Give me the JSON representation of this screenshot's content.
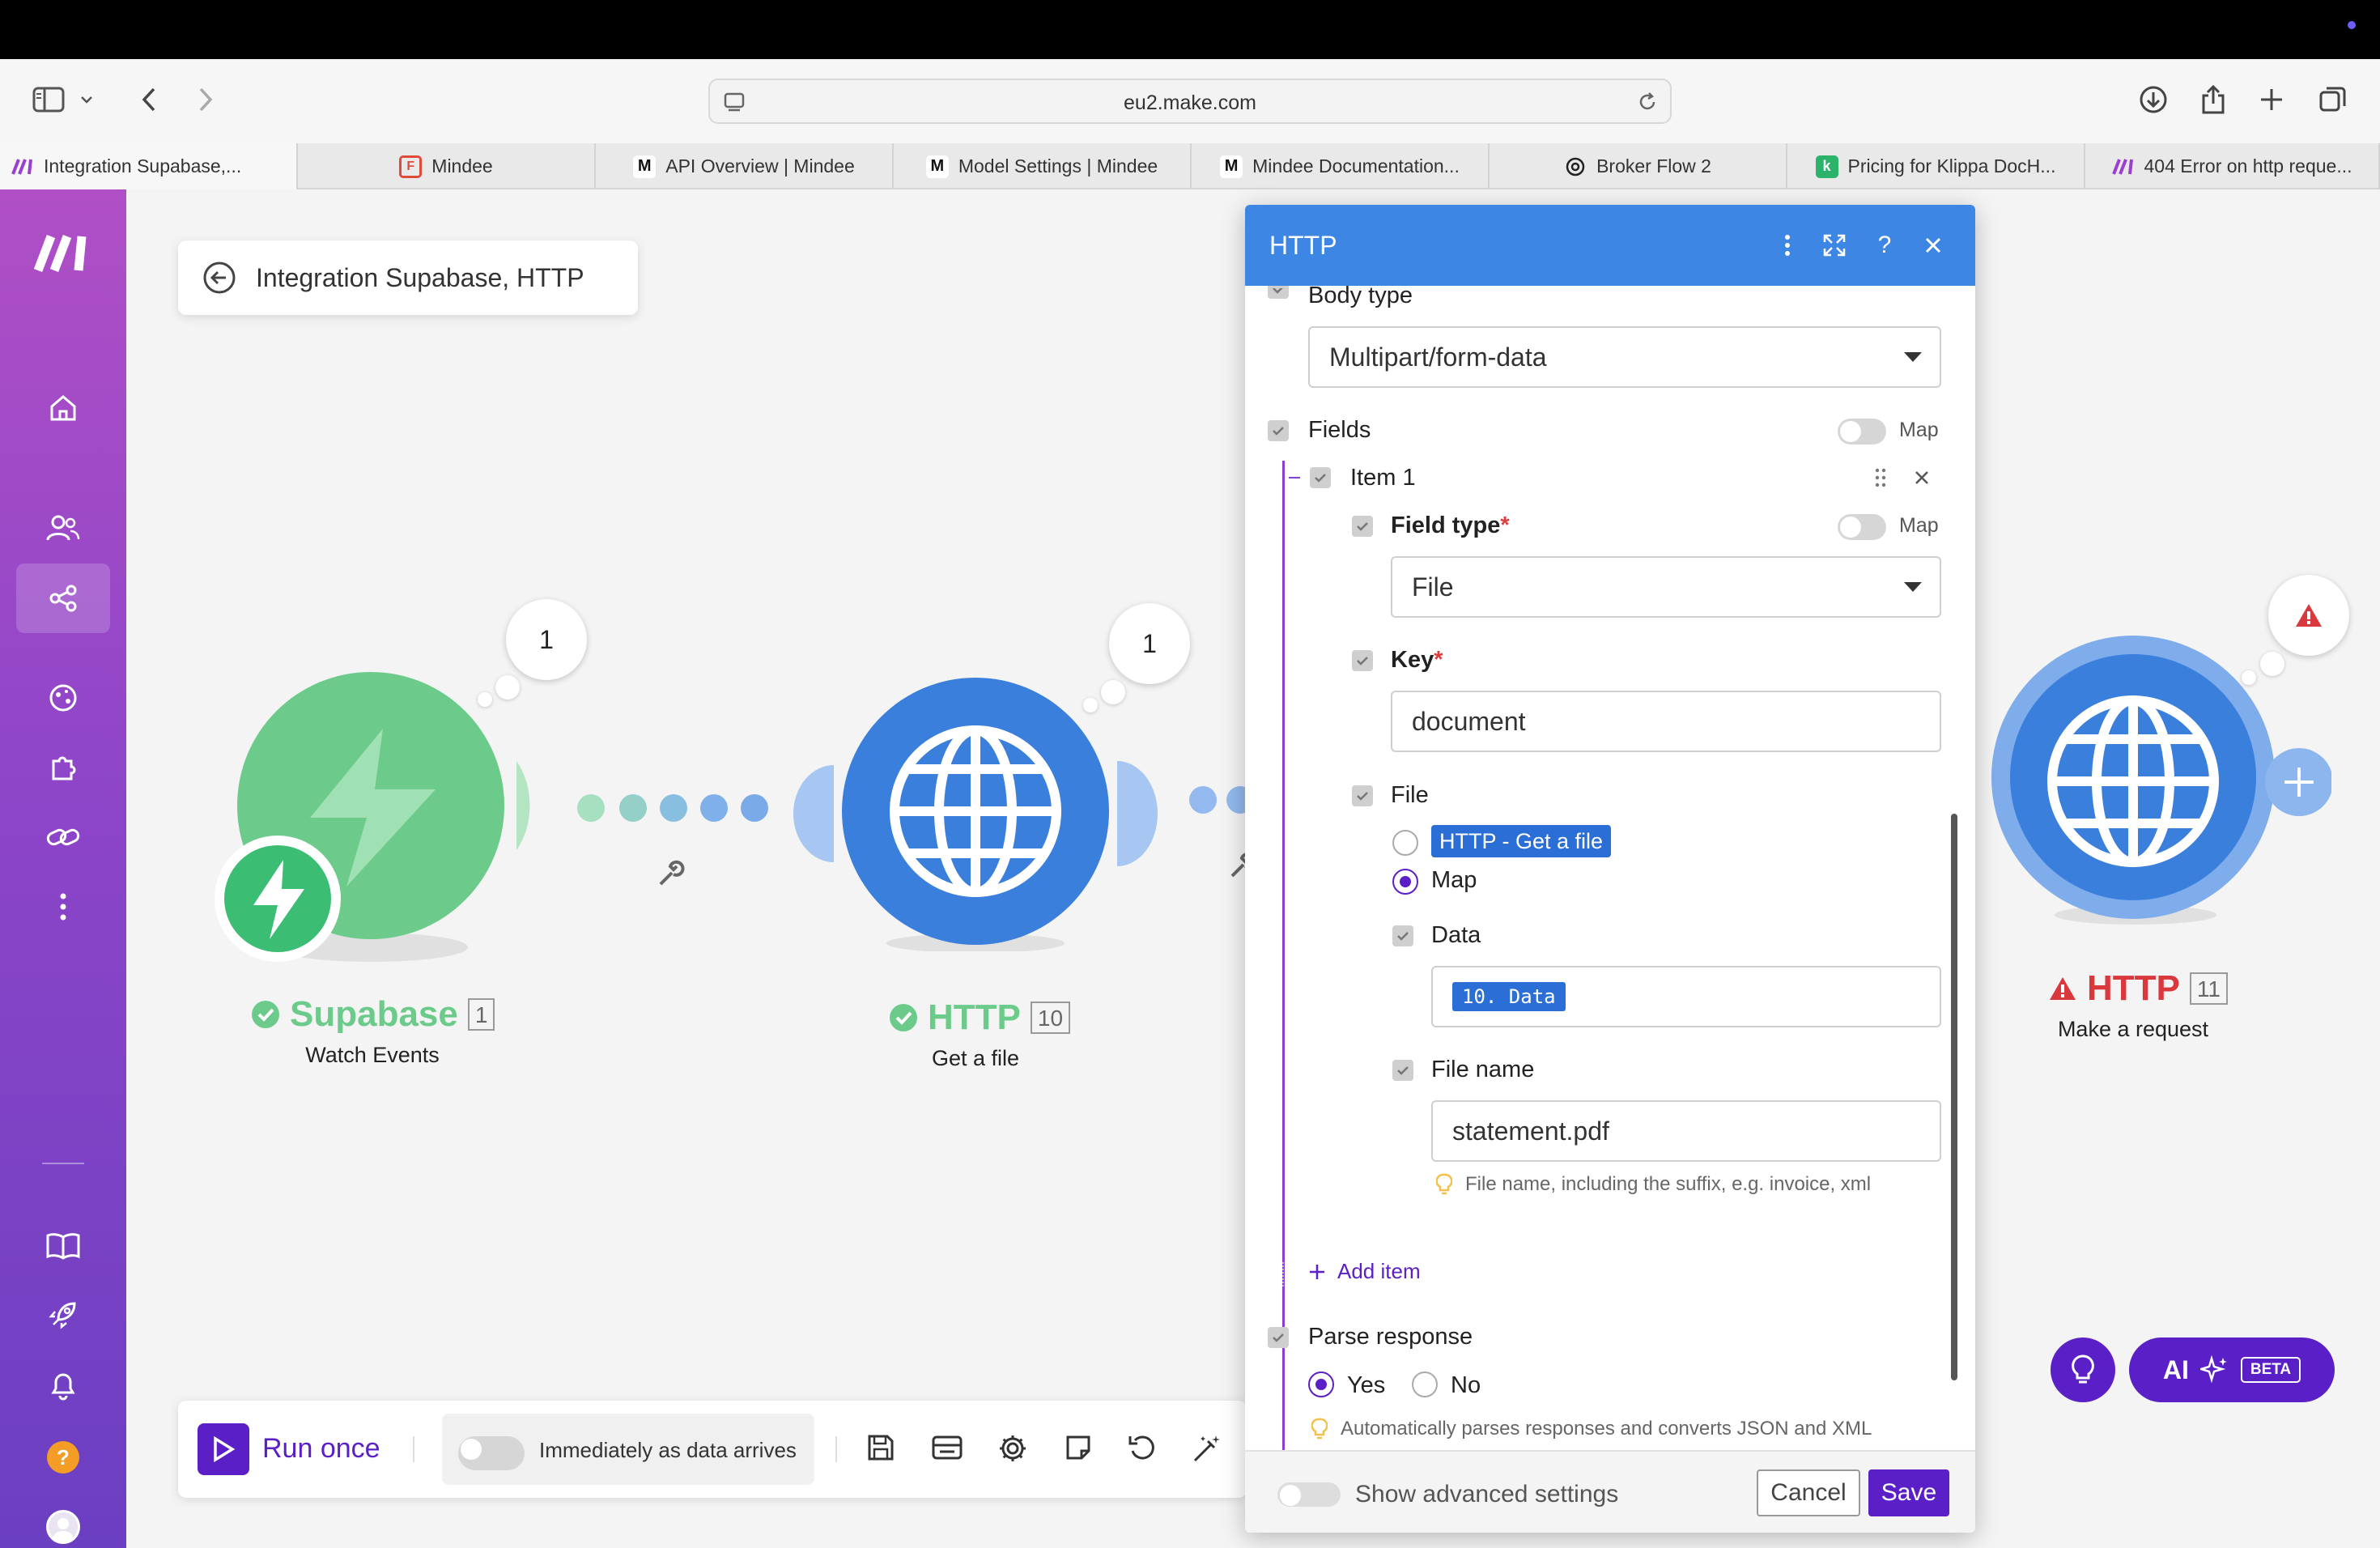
{
  "browser": {
    "url": "eu2.make.com",
    "tabs": [
      {
        "label": "Integration Supabase,...",
        "icon": "make-icon"
      },
      {
        "label": "Mindee",
        "icon": "mindee-icon"
      },
      {
        "label": "API Overview | Mindee",
        "icon": "m-icon"
      },
      {
        "label": "Model Settings | Mindee",
        "icon": "m-icon"
      },
      {
        "label": "Mindee Documentation...",
        "icon": "m-icon"
      },
      {
        "label": "Broker Flow 2",
        "icon": "openai-icon"
      },
      {
        "label": "Pricing for Klippa DocH...",
        "icon": "klippa-icon"
      },
      {
        "label": "404 Error on http reque...",
        "icon": "make-icon"
      }
    ]
  },
  "scenario": {
    "title": "Integration Supabase, HTTP"
  },
  "modules": {
    "supabase": {
      "name": "Supabase",
      "number": "1",
      "subtitle": "Watch Events",
      "bubble": "1",
      "color": "#6ccb8a"
    },
    "http_get": {
      "name": "HTTP",
      "number": "10",
      "subtitle": "Get a file",
      "bubble": "1",
      "color": "#3b7fdc"
    },
    "http_request": {
      "name": "HTTP",
      "number": "11",
      "subtitle": "Make a request",
      "label_color": "#d9383d"
    }
  },
  "bottombar": {
    "run_once": "Run once",
    "schedule": "Immediately as data arrives"
  },
  "assist": {
    "ai_label": "AI",
    "beta": "BETA"
  },
  "modal": {
    "title": "HTTP",
    "body_type_label": "Body type",
    "body_type_value": "Multipart/form-data",
    "fields_label": "Fields",
    "map_label": "Map",
    "item_label": "Item 1",
    "field_type_label": "Field type",
    "field_type_value": "File",
    "key_label": "Key",
    "key_value": "document",
    "file_label": "File",
    "file_option_1": "HTTP - Get a file",
    "file_option_2": "Map",
    "data_label": "Data",
    "data_pill": "10. Data",
    "file_name_label": "File name",
    "file_name_value": "statement.pdf",
    "file_name_hint": "File name, including the suffix, e.g. invoice, xml",
    "add_item": "Add item",
    "parse_response_label": "Parse response",
    "parse_yes": "Yes",
    "parse_no": "No",
    "parse_hint": "Automatically parses responses and converts JSON and XML",
    "advanced_label": "Show advanced settings",
    "cancel": "Cancel",
    "save": "Save",
    "required_mark": "*",
    "accent": "#5a1fc6",
    "header_color": "#3e86e4"
  }
}
